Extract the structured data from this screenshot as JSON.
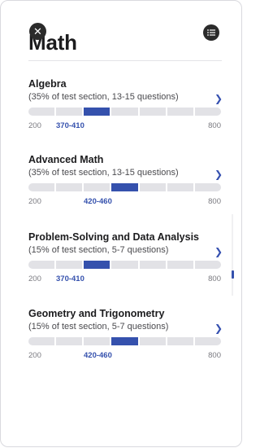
{
  "header": {
    "title": "Math",
    "close_icon": "close-icon",
    "menu_icon": "list-icon"
  },
  "sections": [
    {
      "name": "Algebra",
      "description": "(35% of test section, 13-15 questions)",
      "scale_min": "200",
      "scale_max": "800",
      "range": "370-410",
      "highlight_segment": 2
    },
    {
      "name": "Advanced Math",
      "description": "(35% of test section, 13-15 questions)",
      "scale_min": "200",
      "scale_max": "800",
      "range": "420-460",
      "highlight_segment": 3
    },
    {
      "name": "Problem-Solving and Data Analysis",
      "description": "(15% of test section, 5-7 questions)",
      "scale_min": "200",
      "scale_max": "800",
      "range": "370-410",
      "highlight_segment": 2
    },
    {
      "name": "Geometry and Trigonometry",
      "description": "(15% of test section, 5-7 questions)",
      "scale_min": "200",
      "scale_max": "800",
      "range": "420-460",
      "highlight_segment": 3
    }
  ],
  "colors": {
    "accent": "#3551ad",
    "track": "#e2e2e6",
    "text": "#1c1c1e"
  }
}
